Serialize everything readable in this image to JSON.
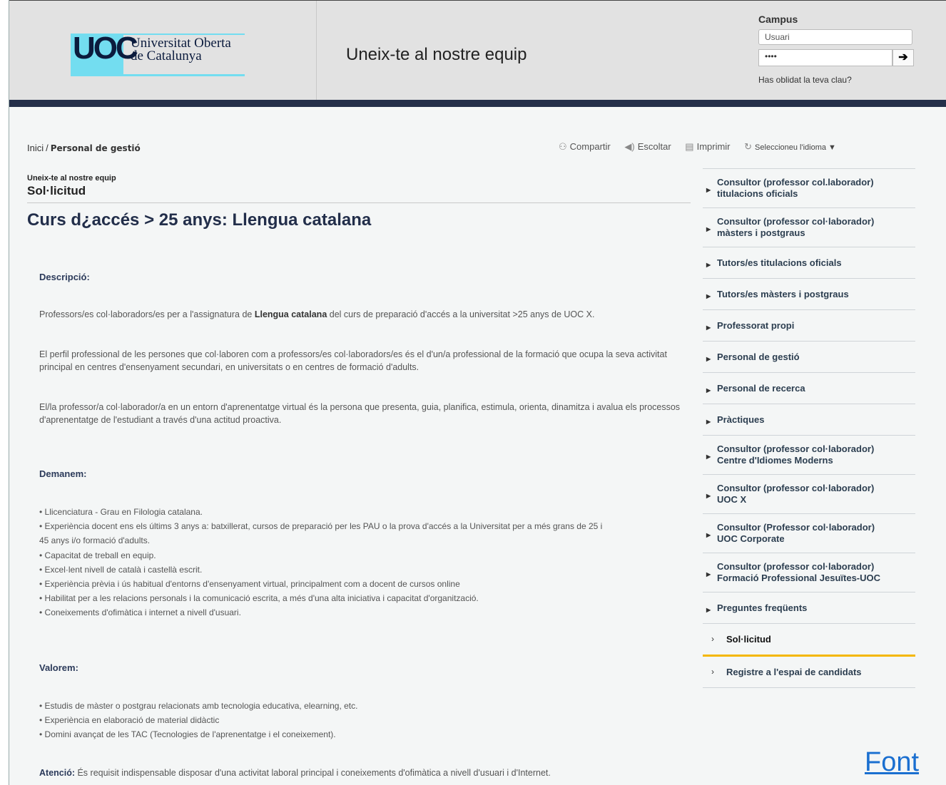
{
  "header": {
    "logo_abbr": "UOC",
    "logo_line1": "Universitat Oberta",
    "logo_line2": "de Catalunya",
    "title": "Uneix-te al nostre equip",
    "campus_label": "Campus",
    "user_placeholder": "Usuari",
    "password_mask": "••••",
    "submit_icon": "arrow-right-icon",
    "forgot": "Has oblidat la teva clau?"
  },
  "breadcrumb": {
    "home": "Inici",
    "separator": "/",
    "current": "Personal de gestió"
  },
  "toolbar": {
    "share": "Compartir",
    "listen": "Escoltar",
    "print": "Imprimir",
    "language": "Seleccioneu l'idioma ▼"
  },
  "content": {
    "sup_title": "Uneix-te al nostre equip",
    "sub_title": "Sol·licitud",
    "page_title": "Curs d¿accés > 25 anys: Llengua catalana",
    "desc_head": "Descripció:",
    "p1_pre": "Professors/es col·laboradors/es per a l'assignatura de ",
    "p1_bold": "Llengua catalana",
    "p1_post": " del curs de preparació d'accés a la universitat >25 anys de UOC X.",
    "p2": "El perfil professional de les persones que col·laboren com a professors/es col·laboradors/es és el d'un/a professional de la formació que ocupa la seva activitat principal en centres d'ensenyament secundari, en universitats o en centres de formació d'adults.",
    "p3": "El/la professor/a col·laborador/a en un entorn d'aprenentatge virtual és la persona que presenta, guia, planifica, estimula, orienta, dinamitza i avalua els processos d'aprenentatge de l'estudiant a través d'una actitud proactiva.",
    "demanem_head": "Demanem:",
    "demanem": [
      "• Llicenciatura - Grau en Filologia catalana.",
      "• Experiència docent ens els últims 3 anys a: batxillerat, cursos de preparació per les PAU o la prova d'accés a la Universitat per a més grans de 25 i",
      "45 anys i/o formació d'adults.",
      "• Capacitat de treball en equip.",
      "• Excel·lent nivell de català i castellà escrit.",
      "• Experiència prèvia i ús habitual d'entorns d'ensenyament virtual, principalment com a docent de cursos online",
      "• Habilitat per a les relacions personals i la comunicació escrita, a més d'una alta iniciativa i capacitat d'organització.",
      "• Coneixements d'ofimàtica i internet a nivell d'usuari."
    ],
    "valorem_head": "Valorem:",
    "valorem": [
      "• Estudis de màster o postgrau relacionats amb tecnologia educativa, elearning, etc.",
      "• Experiència en elaboració de material didàctic",
      "• Domini avançat de les TAC (Tecnologies de l'aprenentatge i el coneixement)."
    ],
    "atencio_bold": "Atenció:",
    "atencio_text": " És requisit indispensable disposar d'una activitat laboral principal i coneixements d'ofimàtica a nivell d'usuari i d'Internet."
  },
  "sidebar": {
    "items": [
      {
        "line1": "Consultor (professor col.laborador)",
        "line2": "titulacions oficials"
      },
      {
        "line1": "Consultor (professor col·laborador)",
        "line2": "màsters i postgraus"
      },
      {
        "line1": "Tutors/es titulacions oficials"
      },
      {
        "line1": "Tutors/es màsters i postgraus"
      },
      {
        "line1": "Professorat propi"
      },
      {
        "line1": "Personal de gestió"
      },
      {
        "line1": "Personal de recerca"
      },
      {
        "line1": "Pràctiques"
      },
      {
        "line1": "Consultor (professor col·laborador)",
        "line2": "Centre d'Idiomes Moderns"
      },
      {
        "line1": "Consultor (professor col·laborador)",
        "line2": "UOC X"
      },
      {
        "line1": "Consultor (Professor col·laborador)",
        "line2": "UOC Corporate"
      },
      {
        "line1": "Consultor (professor col·laborador)",
        "line2": "Formació Professional Jesuïtes-UOC"
      },
      {
        "line1": "Preguntes freqüents"
      }
    ],
    "active": "Sol·licitud",
    "last": "Registre a l'espai de candidats"
  },
  "footer_link": "Font",
  "colors": {
    "header_bg": "#e2e2e2",
    "header_bar": "#242f49",
    "logo_cyan": "#73ddf0",
    "active_underline": "#f4b700",
    "link": "#1a6fd0"
  }
}
